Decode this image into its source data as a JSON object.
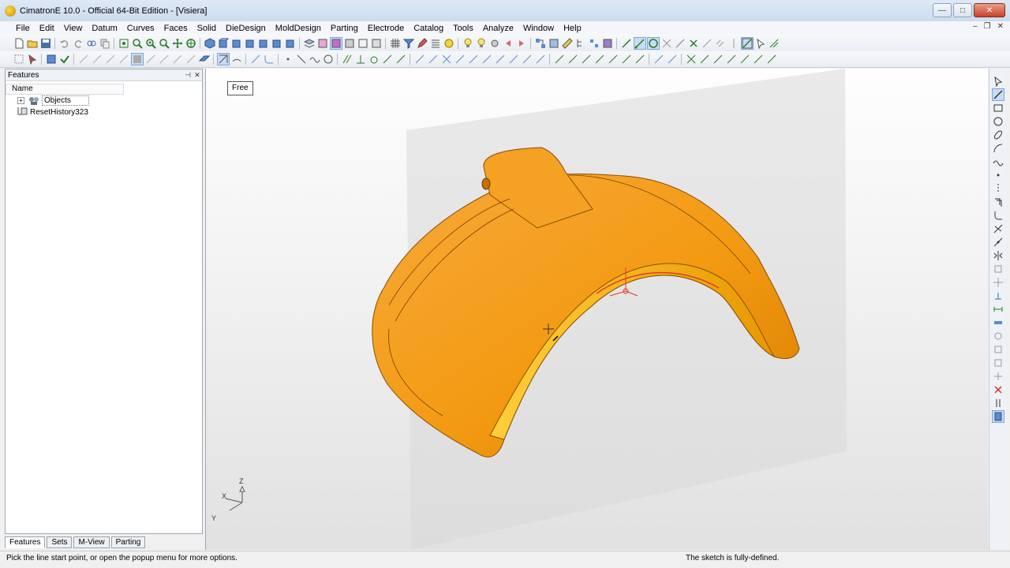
{
  "window": {
    "title": "CimatronE 10.0 - Official 64-Bit Edition - [Visiera]",
    "minimize": "—",
    "maximize": "□",
    "close": "✕"
  },
  "mdi": {
    "minimize": "–",
    "restore": "❐",
    "close": "✕"
  },
  "menu": [
    "File",
    "Edit",
    "View",
    "Datum",
    "Curves",
    "Faces",
    "Solid",
    "DieDesign",
    "MoldDesign",
    "Parting",
    "Electrode",
    "Catalog",
    "Tools",
    "Analyze",
    "Window",
    "Help"
  ],
  "panel": {
    "title": "Features",
    "pin": "⊣",
    "close": "✕",
    "column": "Name",
    "tree": [
      {
        "label": "Objects",
        "expander": "+",
        "icon": "objects-icon"
      },
      {
        "label": "ResetHistory323",
        "icon": "history-icon"
      }
    ]
  },
  "tabs": [
    "Features",
    "Sets",
    "M-View",
    "Parting"
  ],
  "viewport": {
    "mode_label": "Free",
    "axes": {
      "x": "X",
      "y": "Y",
      "z": "Z"
    },
    "model_color": "#f39a12"
  },
  "status": {
    "prompt": "Pick the line start point, or open the popup menu for more options.",
    "sketch_state": "The sketch is fully-defined."
  }
}
